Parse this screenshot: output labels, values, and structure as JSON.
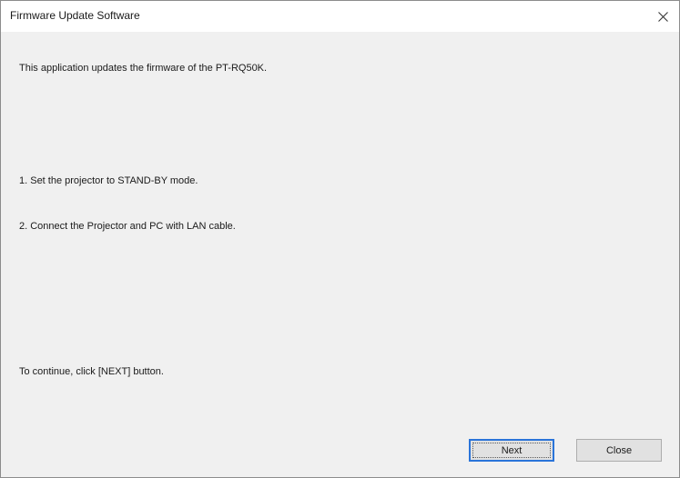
{
  "window": {
    "title": "Firmware Update Software"
  },
  "icons": {
    "close": "close-icon"
  },
  "content": {
    "intro": "This application updates the firmware of the PT-RQ50K.",
    "step1": "1. Set the projector to STAND-BY mode.",
    "step2": "2. Connect the Projector and PC with LAN cable.",
    "instruction": "To continue, click [NEXT] button."
  },
  "buttons": {
    "next_label": "Next",
    "close_label": "Close"
  },
  "colors": {
    "window_bg": "#f0f0f0",
    "titlebar_bg": "#ffffff",
    "default_button_border": "#2a74d9",
    "button_bg": "#e1e1e1"
  }
}
